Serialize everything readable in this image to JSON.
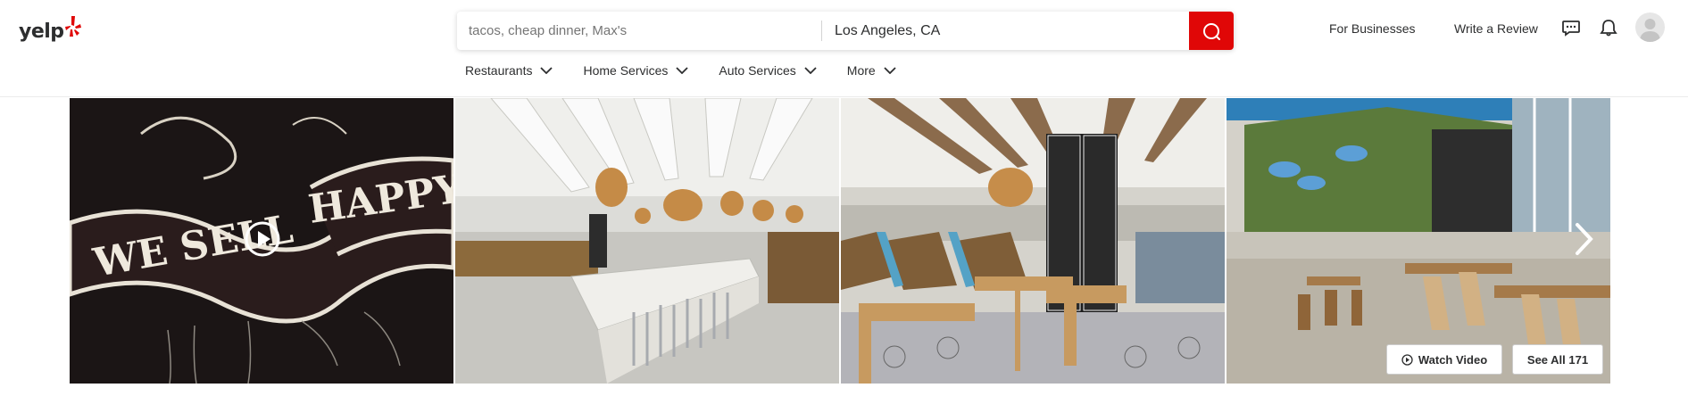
{
  "brand": {
    "logo_text": "yelp",
    "accent": "#e00707"
  },
  "search": {
    "find_placeholder": "tacos, cheap dinner, Max's",
    "near_value": "Los Angeles, CA",
    "button_icon": "search-icon"
  },
  "categories": [
    {
      "label": "Restaurants"
    },
    {
      "label": "Home Services"
    },
    {
      "label": "Auto Services"
    },
    {
      "label": "More"
    }
  ],
  "header_right": {
    "for_businesses": "For Businesses",
    "write_review": "Write a Review",
    "messages_icon": "chat-bubble-icon",
    "notifications_icon": "bell-icon",
    "avatar_icon": "user-avatar-icon"
  },
  "gallery": {
    "photos": [
      {
        "description_icon": "chalkboard-mural-photo",
        "chalk_line_1": "WE SELL",
        "chalk_line_2": "HAPPY"
      },
      {
        "description_icon": "dining-room-photo"
      },
      {
        "description_icon": "counter-seating-photo"
      },
      {
        "description_icon": "cow-wall-photo"
      }
    ],
    "watch_video": "Watch Video",
    "see_all": "See All 171",
    "next_icon": "chevron-right-icon",
    "play_icon": "play-icon"
  }
}
